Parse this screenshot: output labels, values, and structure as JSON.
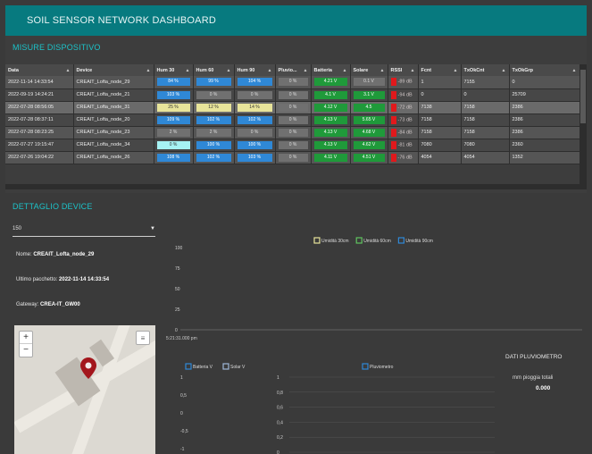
{
  "app": {
    "title": "SOIL SENSOR NETWORK DASHBOARD"
  },
  "table_section": {
    "title": "MISURE DISPOSITIVO",
    "columns": [
      "Data",
      "Device",
      "Hum 30",
      "Hum 60",
      "Hum 90",
      "Pluvio...",
      "Batteria",
      "Solare",
      "RSSI",
      "Fcnt",
      "TxOkCnt",
      "TxOkGrp"
    ],
    "rows": [
      {
        "date": "2022-11-14 14:33:54",
        "device": "CREAIT_Lofta_node_29",
        "hum30": "84 %",
        "hum60": "99 %",
        "hum90": "104 %",
        "pluvio": "0 %",
        "batt": "4.21 V",
        "solar": "0.1 V",
        "rssi": "-89 dB",
        "fcnt": "1",
        "txok": "7155",
        "txokgrp": "0"
      },
      {
        "date": "2022-09-19 14:24:21",
        "device": "CREAIT_Lofta_node_21",
        "hum30": "103 %",
        "hum60": "0 %",
        "hum90": "0 %",
        "pluvio": "0 %",
        "batt": "4.1 V",
        "solar": "3.1 V",
        "rssi": "-94 dB",
        "fcnt": "0",
        "txok": "0",
        "txokgrp": "25709"
      },
      {
        "date": "2022-07-28 08:56:05",
        "device": "CREAIT_Lofta_node_31",
        "hum30": "25 %",
        "hum60": "12 %",
        "hum90": "14 %",
        "pluvio": "0 %",
        "batt": "4.12 V",
        "solar": "4.5",
        "rssi": "-72 dB",
        "fcnt": "7138",
        "txok": "7158",
        "txokgrp": "2386"
      },
      {
        "date": "2022-07-28 08:37:11",
        "device": "CREAIT_Lofta_node_20",
        "hum30": "109 %",
        "hum60": "102 %",
        "hum90": "102 %",
        "pluvio": "0 %",
        "batt": "4.13 V",
        "solar": "5.65 V",
        "rssi": "-73 dB",
        "fcnt": "7158",
        "txok": "7158",
        "txokgrp": "2386"
      },
      {
        "date": "2022-07-28 08:23:25",
        "device": "CREAIT_Lofta_node_23",
        "hum30": "2 %",
        "hum60": "2 %",
        "hum90": "0 %",
        "pluvio": "0 %",
        "batt": "4.13 V",
        "solar": "4.68 V",
        "rssi": "-84 dB",
        "fcnt": "7158",
        "txok": "7158",
        "txokgrp": "2386"
      },
      {
        "date": "2022-07-27 19:15:47",
        "device": "CREAIT_Lofta_node_34",
        "hum30": "0 %",
        "hum60": "100 %",
        "hum90": "100 %",
        "pluvio": "0 %",
        "batt": "4.13 V",
        "solar": "4.62 V",
        "rssi": "-81 dB",
        "fcnt": "7080",
        "txok": "7080",
        "txokgrp": "2360"
      },
      {
        "date": "2022-07-26 19:04:22",
        "device": "CREAIT_Lofta_node_26",
        "hum30": "108 %",
        "hum60": "102 %",
        "hum90": "103 %",
        "pluvio": "0 %",
        "batt": "4.11 V",
        "solar": "4.51 V",
        "rssi": "-76 dB",
        "fcnt": "4054",
        "txok": "4054",
        "txokgrp": "1352"
      }
    ]
  },
  "detail": {
    "title": "DETTAGLIO DEVICE",
    "select_value": "150",
    "name_label": "Nome:",
    "name_value": "CREAIT_Lofta_node_29",
    "last_label": "Ultimo pacchetto:",
    "last_value": "2022-11-14 14:33:54",
    "gw_label": "Gateway:",
    "gw_value": "CREA-IT_GW00",
    "map_zoom_in": "+",
    "map_zoom_out": "−",
    "map_layers": "≡"
  },
  "colors": {
    "header": "#077a7f",
    "accent": "#1cc3c9",
    "blue": "#2f88d6",
    "green": "#1f9a3a",
    "red": "#e0191c"
  },
  "chart_data": [
    {
      "type": "line",
      "legend": [
        "Umidità 30cm",
        "Umidità 60cm",
        "Umidità 90cm"
      ],
      "legend_colors": [
        "#e8e49a",
        "#5fc45f",
        "#2f88d6"
      ],
      "yticks": [
        "100",
        "75",
        "50",
        "25",
        "0"
      ],
      "ylim": [
        0,
        100
      ],
      "xticks": [
        "5:21:31.000 pm"
      ],
      "series": [
        {
          "name": "Umidità 30cm",
          "values": []
        },
        {
          "name": "Umidità 60cm",
          "values": []
        },
        {
          "name": "Umidità 90cm",
          "values": []
        }
      ]
    },
    {
      "type": "line",
      "legend": [
        "Batteria V",
        "Solar V"
      ],
      "legend_colors": [
        "#2f88d6",
        "#9fb7d8"
      ],
      "yticks": [
        "1",
        "0,5",
        "0",
        "-0,5",
        "-1"
      ],
      "ylim": [
        -1,
        1
      ],
      "series": [
        {
          "name": "Batteria V",
          "values": []
        },
        {
          "name": "Solar V",
          "values": []
        }
      ]
    },
    {
      "type": "bar",
      "legend": [
        "Pluviometro"
      ],
      "legend_colors": [
        "#2f88d6"
      ],
      "yticks": [
        "1",
        "0,8",
        "0,6",
        "0,4",
        "0,2",
        "0"
      ],
      "ylim": [
        0,
        1
      ],
      "series": [
        {
          "name": "Pluviometro",
          "values": []
        }
      ]
    }
  ],
  "pluvio": {
    "title": "DATI PLUVIOMETRO",
    "subtitle": "mm pioggia totali",
    "value": "0.000"
  }
}
